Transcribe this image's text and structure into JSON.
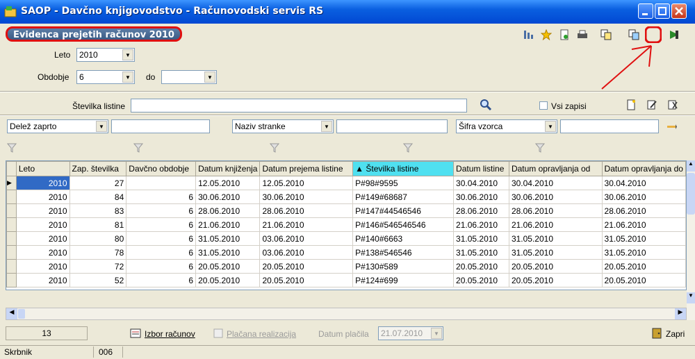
{
  "window": {
    "title": "SAOP -  Davčno knjigovodstvo - Računovodski servis RS"
  },
  "form": {
    "title": "Evidenca prejetih računov 2010"
  },
  "filters": {
    "leto_label": "Leto",
    "leto_value": "2010",
    "obdobje_label": "Obdobje",
    "obdobje_value": "6",
    "do_label": "do",
    "do_value": "",
    "stevilka_label": "Številka listine",
    "stevilka_value": "",
    "vsi_zapisi_label": "Vsi zapisi",
    "delez_zaprto": "Delež zaprto",
    "naziv_stranke": "Naziv stranke",
    "sifra_vzorca": "Šifra vzorca"
  },
  "grid": {
    "columns": [
      "Leto",
      "Zap. številka",
      "Davčno obdobje",
      "Datum knjiženja",
      "Datum prejema listine",
      "Številka listine",
      "Datum listine",
      "Datum opravljanja od",
      "Datum opravljanja do"
    ],
    "rows": [
      [
        "2010",
        "27",
        "",
        "12.05.2010",
        "12.05.2010",
        "P#98#9595",
        "30.04.2010",
        "30.04.2010",
        "30.04.2010"
      ],
      [
        "2010",
        "84",
        "6",
        "30.06.2010",
        "30.06.2010",
        "P#149#68687",
        "30.06.2010",
        "30.06.2010",
        "30.06.2010"
      ],
      [
        "2010",
        "83",
        "6",
        "28.06.2010",
        "28.06.2010",
        "P#147#44546546",
        "28.06.2010",
        "28.06.2010",
        "28.06.2010"
      ],
      [
        "2010",
        "81",
        "6",
        "21.06.2010",
        "21.06.2010",
        "P#146#546546546",
        "21.06.2010",
        "21.06.2010",
        "21.06.2010"
      ],
      [
        "2010",
        "80",
        "6",
        "31.05.2010",
        "03.06.2010",
        "P#140#6663",
        "31.05.2010",
        "31.05.2010",
        "31.05.2010"
      ],
      [
        "2010",
        "78",
        "6",
        "31.05.2010",
        "03.06.2010",
        "P#138#546546",
        "31.05.2010",
        "31.05.2010",
        "31.05.2010"
      ],
      [
        "2010",
        "72",
        "6",
        "20.05.2010",
        "20.05.2010",
        "P#130#589",
        "20.05.2010",
        "20.05.2010",
        "20.05.2010"
      ],
      [
        "2010",
        "52",
        "6",
        "20.05.2010",
        "20.05.2010",
        "P#124#699",
        "20.05.2010",
        "20.05.2010",
        "20.05.2010"
      ]
    ]
  },
  "footer": {
    "count": "13",
    "izbor_racunov": "Izbor računov",
    "placana_realizacija": "Plačana realizacija",
    "datum_placila_label": "Datum plačila",
    "datum_placila_value": "21.07.2010",
    "zapri": "Zapri"
  },
  "statusbar": {
    "user": "Skrbnik",
    "code": "006"
  },
  "colors": {
    "highlight": "#e01010",
    "sorted_column": "#4fe0f0",
    "selection": "#316ac5"
  }
}
